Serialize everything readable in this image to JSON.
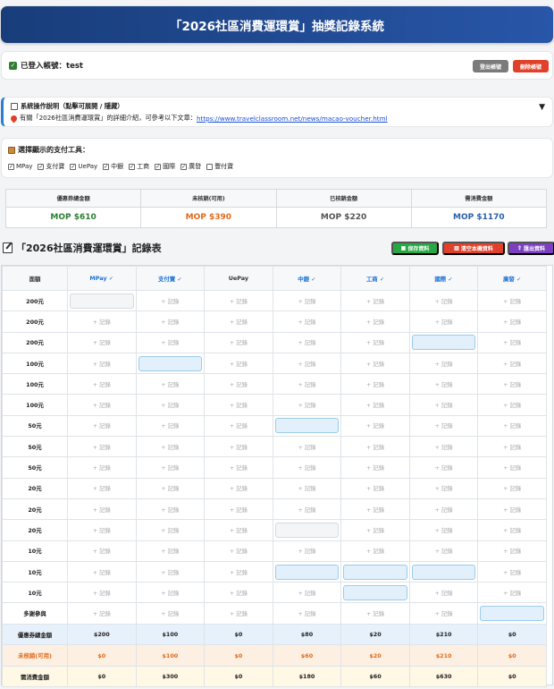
{
  "header": {
    "title": "「2026社區消費運環賞」抽獎記錄系統"
  },
  "login": {
    "status": "已登入帳號：test",
    "logout_label": "登出帳號",
    "delete_label": "刪除帳號"
  },
  "system": {
    "title": "系統操作說明（點擊可展開 / 隱藏）",
    "desc": "有關「2026社區消費運環賞」的詳細介紹，可參考以下文章：",
    "link": "https://www.travelclassroom.net/news/macao-voucher.html"
  },
  "payment": {
    "title": "選擇顯示的支付工具：",
    "options": [
      {
        "label": "MPay",
        "checked": true
      },
      {
        "label": "支付寶",
        "checked": true
      },
      {
        "label": "UePay",
        "checked": true
      },
      {
        "label": "中銀",
        "checked": true
      },
      {
        "label": "工商",
        "checked": true
      },
      {
        "label": "國際",
        "checked": true
      },
      {
        "label": "廣發",
        "checked": true
      },
      {
        "label": "豐付寶",
        "checked": false
      }
    ]
  },
  "summary": [
    {
      "label": "優惠券總金額",
      "value": "MOP $610",
      "color": "#2e7d32"
    },
    {
      "label": "未核銷(可用)",
      "value": "MOP $390",
      "color": "#e06a1b"
    },
    {
      "label": "已核銷金額",
      "value": "MOP $220",
      "color": "#555555"
    },
    {
      "label": "需消費金額",
      "value": "MOP $1170",
      "color": "#2a5fa8"
    }
  ],
  "table": {
    "title": "「2026社區消費運環賞」記錄表",
    "save_label": "保存資料",
    "clear_label": "清空本機資料",
    "export_label": "匯出資料",
    "col0": "面額",
    "columns": [
      {
        "label": "MPay ✓",
        "selected": true
      },
      {
        "label": "支付寶 ✓",
        "selected": true
      },
      {
        "label": "UePay",
        "selected": false
      },
      {
        "label": "中銀 ✓",
        "selected": true
      },
      {
        "label": "工商 ✓",
        "selected": true
      },
      {
        "label": "國際 ✓",
        "selected": true
      },
      {
        "label": "廣發 ✓",
        "selected": true
      }
    ],
    "cell_text": "+ 記錄",
    "rows": [
      {
        "label": "200元",
        "cells": [
          "gray",
          "",
          "",
          "",
          "",
          "",
          ""
        ]
      },
      {
        "label": "200元",
        "cells": [
          "",
          "",
          "",
          "",
          "",
          "",
          ""
        ]
      },
      {
        "label": "200元",
        "cells": [
          "",
          "",
          "",
          "",
          "",
          "blue",
          ""
        ]
      },
      {
        "label": "100元",
        "cells": [
          "",
          "blue",
          "",
          "",
          "",
          "",
          ""
        ]
      },
      {
        "label": "100元",
        "cells": [
          "",
          "",
          "",
          "",
          "",
          "",
          ""
        ]
      },
      {
        "label": "100元",
        "cells": [
          "",
          "",
          "",
          "",
          "",
          "",
          ""
        ]
      },
      {
        "label": "50元",
        "cells": [
          "",
          "",
          "",
          "blue",
          "",
          "",
          ""
        ]
      },
      {
        "label": "50元",
        "cells": [
          "",
          "",
          "",
          "",
          "",
          "",
          ""
        ]
      },
      {
        "label": "50元",
        "cells": [
          "",
          "",
          "",
          "",
          "",
          "",
          ""
        ]
      },
      {
        "label": "20元",
        "cells": [
          "",
          "",
          "",
          "",
          "",
          "",
          ""
        ]
      },
      {
        "label": "20元",
        "cells": [
          "",
          "",
          "",
          "",
          "",
          "",
          ""
        ]
      },
      {
        "label": "20元",
        "cells": [
          "",
          "",
          "",
          "gray",
          "",
          "",
          ""
        ]
      },
      {
        "label": "10元",
        "cells": [
          "",
          "",
          "",
          "",
          "",
          "",
          ""
        ]
      },
      {
        "label": "10元",
        "cells": [
          "",
          "",
          "",
          "blue",
          "blue",
          "blue",
          ""
        ]
      },
      {
        "label": "10元",
        "cells": [
          "",
          "",
          "",
          "",
          "blue",
          "",
          ""
        ]
      },
      {
        "label": "多謝參與",
        "cells": [
          "",
          "",
          "",
          "",
          "",
          "",
          "blue"
        ]
      }
    ],
    "totals": [
      {
        "label": "優惠券總金額",
        "values": [
          "$200",
          "$100",
          "$0",
          "$80",
          "$20",
          "$210",
          "$0"
        ]
      },
      {
        "label": "未核銷(可用)",
        "values": [
          "$0",
          "$100",
          "$0",
          "$60",
          "$20",
          "$210",
          "$0"
        ]
      },
      {
        "label": "需消費金額",
        "values": [
          "$0",
          "$300",
          "$0",
          "$180",
          "$60",
          "$630",
          "$0"
        ]
      }
    ]
  },
  "colors": {
    "primary": "#1f4b94",
    "accent": "#2a7fd4"
  }
}
